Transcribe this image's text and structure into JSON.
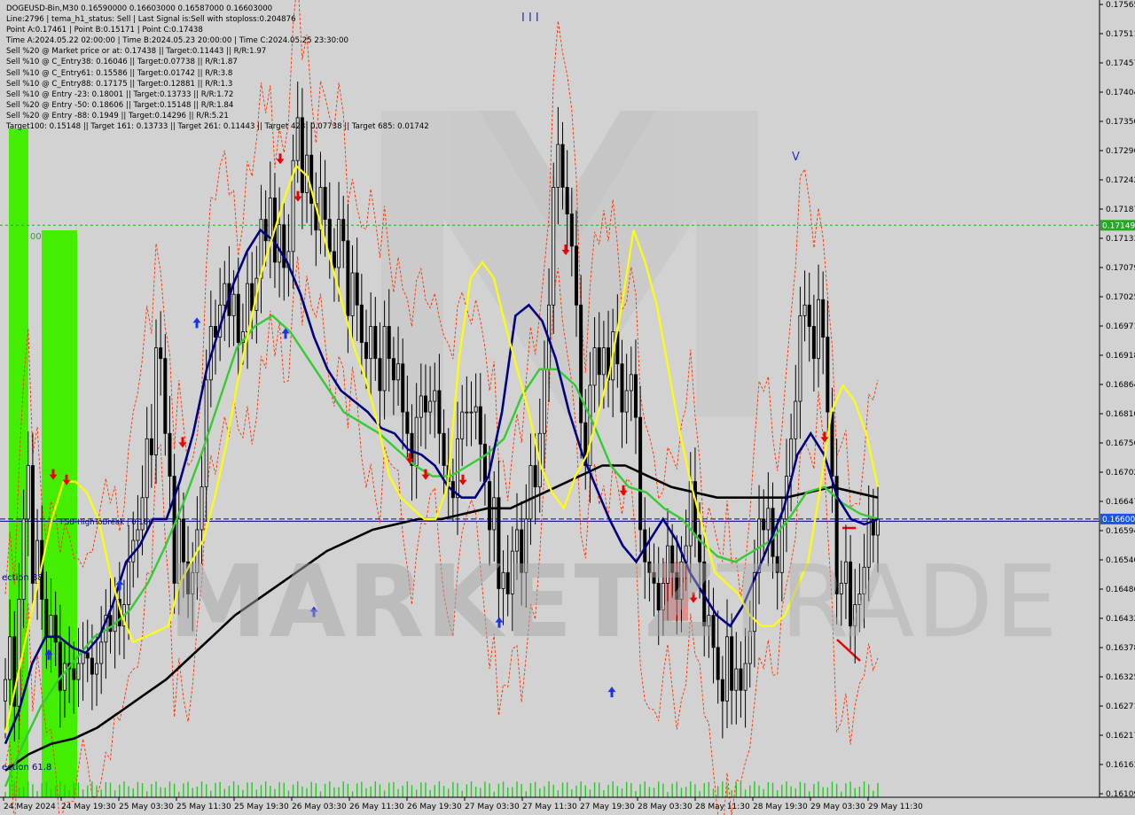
{
  "info": {
    "lines": [
      "DOGEUSD-Bin,M30  0.16590000 0.16603000 0.16587000 0.16603000",
      "Line:2796 | tema_h1_status: Sell | Last Signal is:Sell with stoploss:0.204876",
      "Point A:0.17461 | Point B:0.15171 | Point C:0.17438",
      "Time A:2024.05.22 02:00:00 | Time B:2024.05.23 20:00:00 | Time C:2024.05.25 23:30:00",
      "Sell %20 @ Market price or at: 0.17438 || Target:0.11443 || R/R:1.97",
      "Sell %10 @ C_Entry38: 0.16046 || Target:0.07738 || R/R:1.87",
      "Sell %10 @ C_Entry61: 0.15586 || Target:0.01742 || R/R:3.8",
      "Sell %10 @ C_Entry88: 0.17175 || Target:0.12881 || R/R:1.3",
      "Sell %10 @ Entry -23: 0.18001 || Target:0.13733 || R/R:1.72",
      "Sell %20 @ Entry -50: 0.18606 || Target:0.15148 || R/R:1.84",
      "Sell %20 @ Entry -88: 0.1949 || Target:0.14296 || R/R:5.21",
      "Target100: 0.15148 || Target 161: 0.13733 || Target 261: 0.11443 || Target 423: 0.07738 || Target 685: 0.01742"
    ]
  },
  "watermark": {
    "part1": "MARKETZ",
    "part2": "TRADE"
  },
  "labels": {
    "fsb": "FSB-HighToBreak | 0.166",
    "wave_top": "I I I",
    "wave_v": "V",
    "zero_label": "00",
    "left_label_1": "ection 38",
    "left_label_2": "ection 61.8"
  },
  "colors": {
    "background": "#d2d2d2",
    "bull_candle": "#000000",
    "bear_candle": "#000000",
    "ma_yellow": "#ffff00",
    "ma_navy": "#000080",
    "ma_green": "#33cc33",
    "ma_black": "#000000",
    "envelope": "#ff3300",
    "current_price_bg": "#1a55e8",
    "level_green_bg": "#22aa22",
    "blue_line": "#0000cc",
    "green_dotted": "#22aa22",
    "green_bar": "#44ee00",
    "red_zone": "#f08080"
  },
  "chart_data": {
    "type": "candlestick",
    "symbol": "DOGEUSD-Bin",
    "timeframe": "M30",
    "y_range": [
      0.1608,
      0.1757
    ],
    "y_ticks": [
      "0.17565",
      "0.17511",
      "0.17457",
      "0.17404",
      "0.17350",
      "0.17296",
      "0.17242",
      "0.17187",
      "0.17133",
      "0.17079",
      "0.17025",
      "0.16971",
      "0.16918",
      "0.16864",
      "0.16810",
      "0.16756",
      "0.16702",
      "0.16647",
      "0.16594",
      "0.16540",
      "0.16486",
      "0.16432",
      "0.16378",
      "0.16325",
      "0.16271",
      "0.16217",
      "0.16163",
      "0.16109"
    ],
    "x_ticks": [
      "24 May 2024",
      "24 May 19:30",
      "25 May 03:30",
      "25 May 11:30",
      "25 May 19:30",
      "26 May 03:30",
      "26 May 11:30",
      "26 May 19:30",
      "27 May 03:30",
      "27 May 11:30",
      "27 May 19:30",
      "28 May 03:30",
      "28 May 11:30",
      "28 May 19:30",
      "29 May 03:30",
      "29 May 11:30"
    ],
    "current_price": "0.16600",
    "level_green_price": "0.17149",
    "fsb_level": 0.16596,
    "point_a": 0.17461,
    "point_b": 0.15171,
    "point_c": 0.17438,
    "closes": [
      0.163,
      0.1638,
      0.1625,
      0.1645,
      0.166,
      0.167,
      0.1648,
      0.1656,
      0.1645,
      0.1638,
      0.1642,
      0.1637,
      0.1628,
      0.1633,
      0.1632,
      0.163,
      0.1633,
      0.1635,
      0.1634,
      0.1631,
      0.1633,
      0.1637,
      0.1642,
      0.1639,
      0.1645,
      0.164,
      0.1644,
      0.1652,
      0.1656,
      0.1658,
      0.1664,
      0.1675,
      0.1672,
      0.1692,
      0.169,
      0.1676,
      0.1668,
      0.1648,
      0.166,
      0.1652,
      0.1646,
      0.165,
      0.1658,
      0.1666,
      0.1686,
      0.1696,
      0.1694,
      0.17,
      0.1704,
      0.1698,
      0.1702,
      0.1693,
      0.1695,
      0.1704,
      0.1699,
      0.1705,
      0.1716,
      0.1712,
      0.172,
      0.1708,
      0.1715,
      0.1707,
      0.171,
      0.1727,
      0.1735,
      0.1721,
      0.1728,
      0.1719,
      0.1714,
      0.1722,
      0.1716,
      0.171,
      0.1707,
      0.1716,
      0.1712,
      0.1698,
      0.1706,
      0.17,
      0.1693,
      0.169,
      0.1696,
      0.169,
      0.1684,
      0.1696,
      0.169,
      0.1686,
      0.1689,
      0.168,
      0.1676,
      0.167,
      0.1679,
      0.1683,
      0.168,
      0.1682,
      0.1684,
      0.1676,
      0.167,
      0.1667,
      0.1664,
      0.1675,
      0.168,
      0.168,
      0.168,
      0.1681,
      0.1674,
      0.1667,
      0.1658,
      0.1664,
      0.1647,
      0.165,
      0.1646,
      0.1654,
      0.1658,
      0.165,
      0.166,
      0.167,
      0.1666,
      0.1676,
      0.1688,
      0.17,
      0.1722,
      0.173,
      0.1722,
      0.1717,
      0.1711,
      0.17,
      0.1678,
      0.167,
      0.1685,
      0.1692,
      0.1687,
      0.1692,
      0.1686,
      0.1695,
      0.1689,
      0.168,
      0.1684,
      0.1687,
      0.1679,
      0.1658,
      0.1652,
      0.165,
      0.1648,
      0.1643,
      0.1648,
      0.1655,
      0.165,
      0.1645,
      0.1652,
      0.1655,
      0.1667,
      0.1657,
      0.1652,
      0.164,
      0.1642,
      0.1636,
      0.163,
      0.1626,
      0.1638,
      0.1628,
      0.1632,
      0.1628,
      0.1633,
      0.1639,
      0.165,
      0.166,
      0.1658,
      0.1662,
      0.1653,
      0.165,
      0.166,
      0.1668,
      0.1675,
      0.1682,
      0.1698,
      0.17,
      0.1696,
      0.169,
      0.1701,
      0.1694,
      0.168,
      0.1668,
      0.1646,
      0.1648,
      0.1652,
      0.164,
      0.1644,
      0.1646,
      0.1651,
      0.166,
      0.1657,
      0.166
    ],
    "ma_yellow": [
      0.162,
      0.163,
      0.164,
      0.165,
      0.166,
      0.1667,
      0.1667,
      0.1665,
      0.166,
      0.165,
      0.1642,
      0.1637,
      0.1638,
      0.1639,
      0.164,
      0.1648,
      0.1652,
      0.1656,
      0.1664,
      0.1674,
      0.1686,
      0.1696,
      0.1706,
      0.1713,
      0.172,
      0.1726,
      0.1724,
      0.1716,
      0.1708,
      0.17,
      0.1692,
      0.1686,
      0.1678,
      0.1668,
      0.1664,
      0.1662,
      0.166,
      0.166,
      0.1666,
      0.169,
      0.1705,
      0.1708,
      0.1705,
      0.1696,
      0.1688,
      0.168,
      0.167,
      0.1665,
      0.1662,
      0.1668,
      0.1672,
      0.168,
      0.1688,
      0.17,
      0.1714,
      0.1708,
      0.17,
      0.1688,
      0.1676,
      0.1666,
      0.1658,
      0.165,
      0.1648,
      0.1646,
      0.1642,
      0.164,
      0.164,
      0.1642,
      0.1647,
      0.1652,
      0.1665,
      0.168,
      0.1685,
      0.1682,
      0.1676,
      0.1666
    ],
    "ma_navy": [
      0.1618,
      0.1624,
      0.1633,
      0.1638,
      0.1638,
      0.1636,
      0.1635,
      0.1638,
      0.1644,
      0.1652,
      0.1655,
      0.166,
      0.166,
      0.1667,
      0.1676,
      0.1688,
      0.1696,
      0.1704,
      0.171,
      0.1714,
      0.1712,
      0.1708,
      0.1702,
      0.1694,
      0.1688,
      0.1684,
      0.1682,
      0.168,
      0.1677,
      0.1676,
      0.1673,
      0.1672,
      0.167,
      0.1666,
      0.1664,
      0.1664,
      0.1668,
      0.168,
      0.1698,
      0.17,
      0.1697,
      0.169,
      0.168,
      0.1672,
      0.1666,
      0.166,
      0.1655,
      0.1652,
      0.1656,
      0.166,
      0.1656,
      0.165,
      0.1646,
      0.1642,
      0.164,
      0.1644,
      0.165,
      0.1656,
      0.1662,
      0.1672,
      0.1676,
      0.1672,
      0.1664,
      0.166,
      0.1659,
      0.166
    ],
    "ma_green": [
      0.161,
      0.1618,
      0.1625,
      0.163,
      0.1634,
      0.1638,
      0.164,
      0.1643,
      0.1648,
      0.1655,
      0.1663,
      0.1672,
      0.1682,
      0.1692,
      0.1696,
      0.1698,
      0.1695,
      0.169,
      0.1685,
      0.168,
      0.1678,
      0.1676,
      0.1673,
      0.167,
      0.1668,
      0.1668,
      0.167,
      0.1672,
      0.1675,
      0.1683,
      0.1688,
      0.1688,
      0.1685,
      0.1678,
      0.167,
      0.1666,
      0.1665,
      0.1662,
      0.166,
      0.1656,
      0.1653,
      0.1652,
      0.1654,
      0.1656,
      0.166,
      0.1665,
      0.1666,
      0.1663,
      0.1661,
      0.166
    ],
    "ma_black": [
      0.1613,
      0.1616,
      0.1618,
      0.1619,
      0.1621,
      0.1624,
      0.1627,
      0.163,
      0.1634,
      0.1638,
      0.1642,
      0.1645,
      0.1648,
      0.1651,
      0.1654,
      0.1656,
      0.1658,
      0.1659,
      0.166,
      0.166,
      0.1661,
      0.1662,
      0.1662,
      0.1664,
      0.1666,
      0.1668,
      0.167,
      0.167,
      0.1668,
      0.1666,
      0.1665,
      0.1664,
      0.1664,
      0.1664,
      0.1664,
      0.1665,
      0.1666,
      0.1665,
      0.1664
    ],
    "sell_arrows": [
      [
        0.168,
        0.1666
      ],
      [
        0.1667,
        0.1665
      ],
      [
        0.1673,
        0.1672
      ],
      [
        0.1674,
        0.1725
      ],
      [
        0.172,
        0.1718
      ],
      [
        0.1669,
        0.1669
      ],
      [
        0.1668,
        0.1666
      ],
      [
        0.1664,
        0.1665
      ],
      [
        0.1672,
        0.1708
      ],
      [
        0.167,
        0.1663
      ],
      [
        0.1647,
        0.1643
      ],
      [
        0.1672,
        0.1673
      ]
    ],
    "buy_arrows": [
      [
        0.1637,
        0.1637
      ],
      [
        0.1657,
        0.165
      ],
      [
        0.1686,
        0.1699
      ],
      [
        0.1711,
        0.1697
      ],
      [
        0.1658,
        0.1645
      ],
      [
        0.1676,
        0.1643
      ],
      [
        0.1631,
        0.163
      ]
    ]
  }
}
